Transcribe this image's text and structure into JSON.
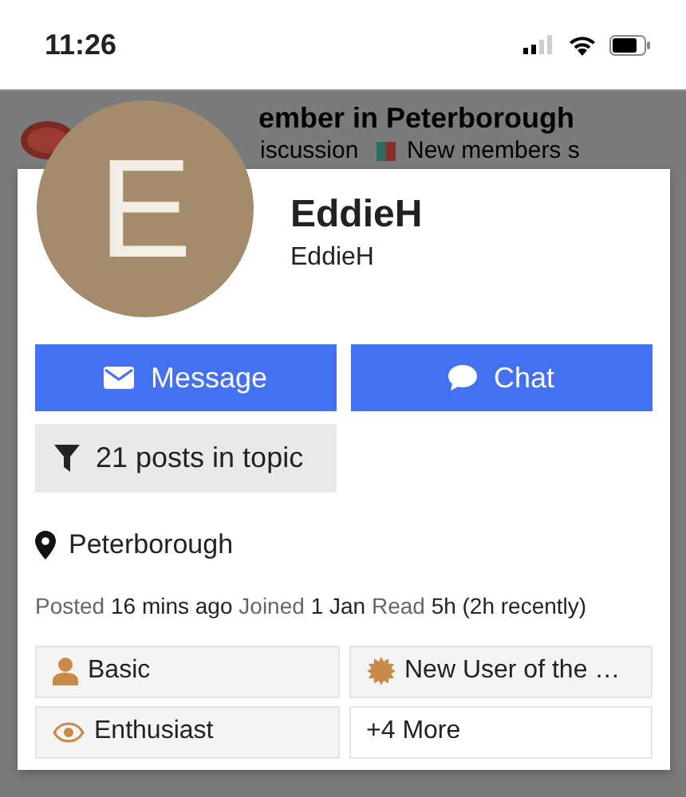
{
  "status_bar": {
    "time": "11:26"
  },
  "topic": {
    "title": "ember in Peterborough",
    "category": "iscussion",
    "subcategory": "New members s"
  },
  "user": {
    "avatar_letter": "E",
    "name": "EddieH",
    "username": "EddieH"
  },
  "actions": [
    {
      "label": "Message",
      "kind": "message"
    },
    {
      "label": "Chat",
      "kind": "chat"
    }
  ],
  "filter_button": {
    "label": "21 posts in topic"
  },
  "location": "Peterborough",
  "stats": [
    {
      "label": "Posted",
      "value": "16 mins ago"
    },
    {
      "label": "Joined",
      "value": "1 Jan"
    },
    {
      "label": "Read",
      "value": "5h (2h recently)"
    }
  ],
  "badges": [
    {
      "label": "Basic",
      "kind": "user"
    },
    {
      "label": "New User of the …",
      "kind": "certificate"
    },
    {
      "label": "Enthusiast",
      "kind": "eye"
    },
    {
      "label": "+4 More",
      "kind": "more"
    }
  ]
}
